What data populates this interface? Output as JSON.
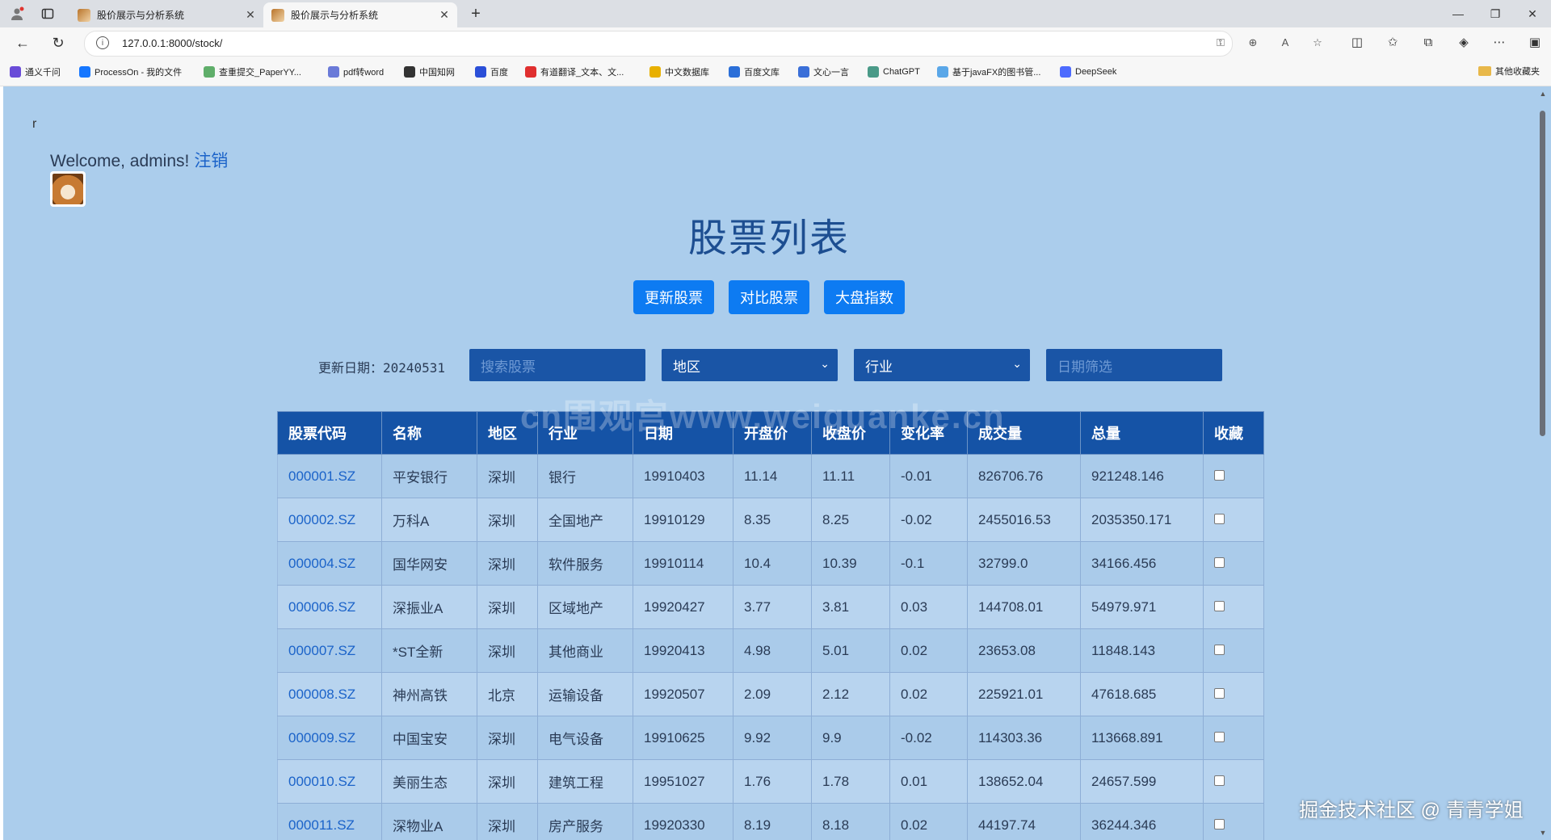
{
  "browser": {
    "tabs": [
      {
        "title": "股价展示与分析系统",
        "active": false
      },
      {
        "title": "股价展示与分析系统",
        "active": true
      }
    ],
    "url": "127.0.0.1:8000/stock/",
    "bookmarks": [
      {
        "label": "通义千问",
        "color": "#6a4cd8"
      },
      {
        "label": "ProcessOn - 我的文件",
        "color": "#1677ff"
      },
      {
        "label": "查重提交_PaperYY...",
        "color": "#5fae6a"
      },
      {
        "label": "pdf转word",
        "color": "#6a7ad8"
      },
      {
        "label": "中国知网",
        "color": "#333333"
      },
      {
        "label": "百度",
        "color": "#2b4fd8"
      },
      {
        "label": "有道翻译_文本、文...",
        "color": "#e02f2f"
      },
      {
        "label": "中文数据库",
        "color": "#e8b000"
      },
      {
        "label": "百度文库",
        "color": "#2b6fd8"
      },
      {
        "label": "文心一言",
        "color": "#3a6fd8"
      },
      {
        "label": "ChatGPT",
        "color": "#4a9a88"
      },
      {
        "label": "基于javaFX的图书管...",
        "color": "#5aa7e8"
      },
      {
        "label": "DeepSeek",
        "color": "#4d6bfe"
      }
    ],
    "other_bookmarks": "其他收藏夹"
  },
  "page": {
    "stray_text": "r",
    "welcome": "Welcome, admins!",
    "logout": "注销",
    "title": "股票列表",
    "buttons": [
      "更新股票",
      "对比股票",
      "大盘指数"
    ],
    "update_label": "更新日期：20240531",
    "search_placeholder": "搜索股票",
    "region_select": "地区",
    "industry_select": "行业",
    "date_placeholder": "日期筛选"
  },
  "table": {
    "headers": [
      "股票代码",
      "名称",
      "地区",
      "行业",
      "日期",
      "开盘价",
      "收盘价",
      "变化率",
      "成交量",
      "总量",
      "收藏"
    ],
    "rows": [
      [
        "000001.SZ",
        "平安银行",
        "深圳",
        "银行",
        "19910403",
        "11.14",
        "11.11",
        "-0.01",
        "826706.76",
        "921248.146"
      ],
      [
        "000002.SZ",
        "万科A",
        "深圳",
        "全国地产",
        "19910129",
        "8.35",
        "8.25",
        "-0.02",
        "2455016.53",
        "2035350.171"
      ],
      [
        "000004.SZ",
        "国华网安",
        "深圳",
        "软件服务",
        "19910114",
        "10.4",
        "10.39",
        "-0.1",
        "32799.0",
        "34166.456"
      ],
      [
        "000006.SZ",
        "深振业A",
        "深圳",
        "区域地产",
        "19920427",
        "3.77",
        "3.81",
        "0.03",
        "144708.01",
        "54979.971"
      ],
      [
        "000007.SZ",
        "*ST全新",
        "深圳",
        "其他商业",
        "19920413",
        "4.98",
        "5.01",
        "0.02",
        "23653.08",
        "11848.143"
      ],
      [
        "000008.SZ",
        "神州高铁",
        "北京",
        "运输设备",
        "19920507",
        "2.09",
        "2.12",
        "0.02",
        "225921.01",
        "47618.685"
      ],
      [
        "000009.SZ",
        "中国宝安",
        "深圳",
        "电气设备",
        "19910625",
        "9.92",
        "9.9",
        "-0.02",
        "114303.36",
        "113668.891"
      ],
      [
        "000010.SZ",
        "美丽生态",
        "深圳",
        "建筑工程",
        "19951027",
        "1.76",
        "1.78",
        "0.01",
        "138652.04",
        "24657.599"
      ],
      [
        "000011.SZ",
        "深物业A",
        "深圳",
        "房产服务",
        "19920330",
        "8.19",
        "8.18",
        "0.02",
        "44197.74",
        "36244.346"
      ]
    ]
  },
  "overlay": {
    "watermark": "cn围观宫www.weiguanke.cn",
    "credit": "掘金技术社区 @ 青青学姐"
  }
}
